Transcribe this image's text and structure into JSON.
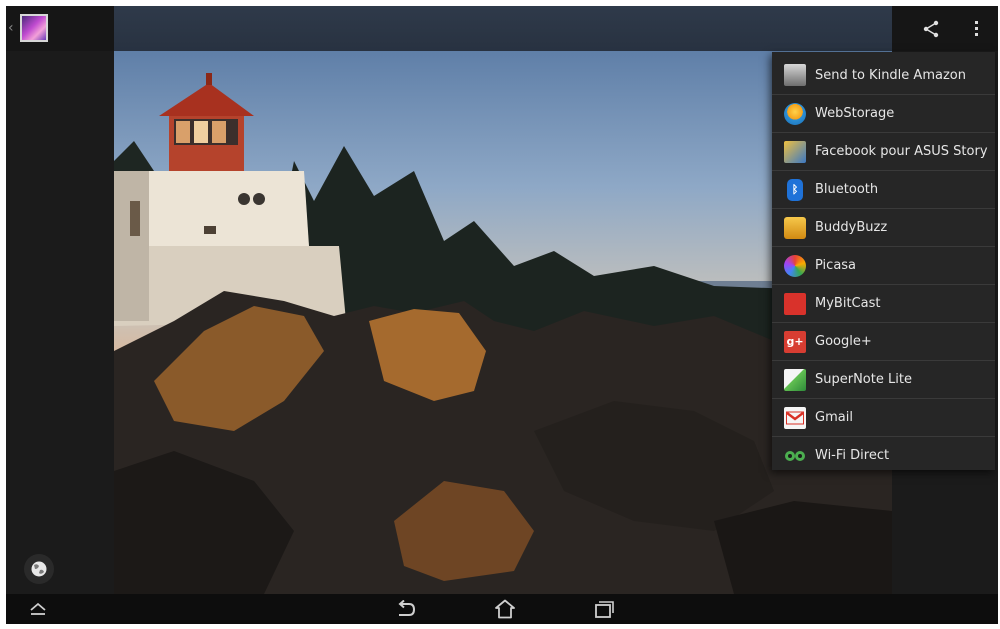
{
  "actionbar": {
    "app_icon": "gallery-app-icon",
    "up_icon": "chevron-left-icon",
    "share_icon": "share-icon",
    "overflow_icon": "overflow-menu-icon"
  },
  "photo": {
    "subject": "lighthouse-photo"
  },
  "share_menu": {
    "items": [
      {
        "label": "Send to Kindle Amazon",
        "icon": "kindle-icon"
      },
      {
        "label": "WebStorage",
        "icon": "webstorage-icon"
      },
      {
        "label": "Facebook pour ASUS Story",
        "icon": "facebook-icon"
      },
      {
        "label": "Bluetooth",
        "icon": "bluetooth-icon"
      },
      {
        "label": "BuddyBuzz",
        "icon": "buddybuzz-icon"
      },
      {
        "label": "Picasa",
        "icon": "picasa-icon"
      },
      {
        "label": "MyBitCast",
        "icon": "mybitcast-icon"
      },
      {
        "label": "Google+",
        "icon": "googleplus-icon"
      },
      {
        "label": "SuperNote Lite",
        "icon": "supernote-icon"
      },
      {
        "label": "Gmail",
        "icon": "gmail-icon"
      },
      {
        "label": "Wi-Fi Direct",
        "icon": "wifi-direct-icon"
      }
    ]
  },
  "globe_icon": "globe-icon",
  "navbar": {
    "menu_icon": "menu-up-icon",
    "back_icon": "back-icon",
    "home_icon": "home-icon",
    "recents_icon": "recent-apps-icon"
  },
  "colors": {
    "actionbar": "#161616",
    "menu_background": "#262626",
    "menu_text": "#e6e6e6",
    "navbar": "#0d0d0d"
  }
}
